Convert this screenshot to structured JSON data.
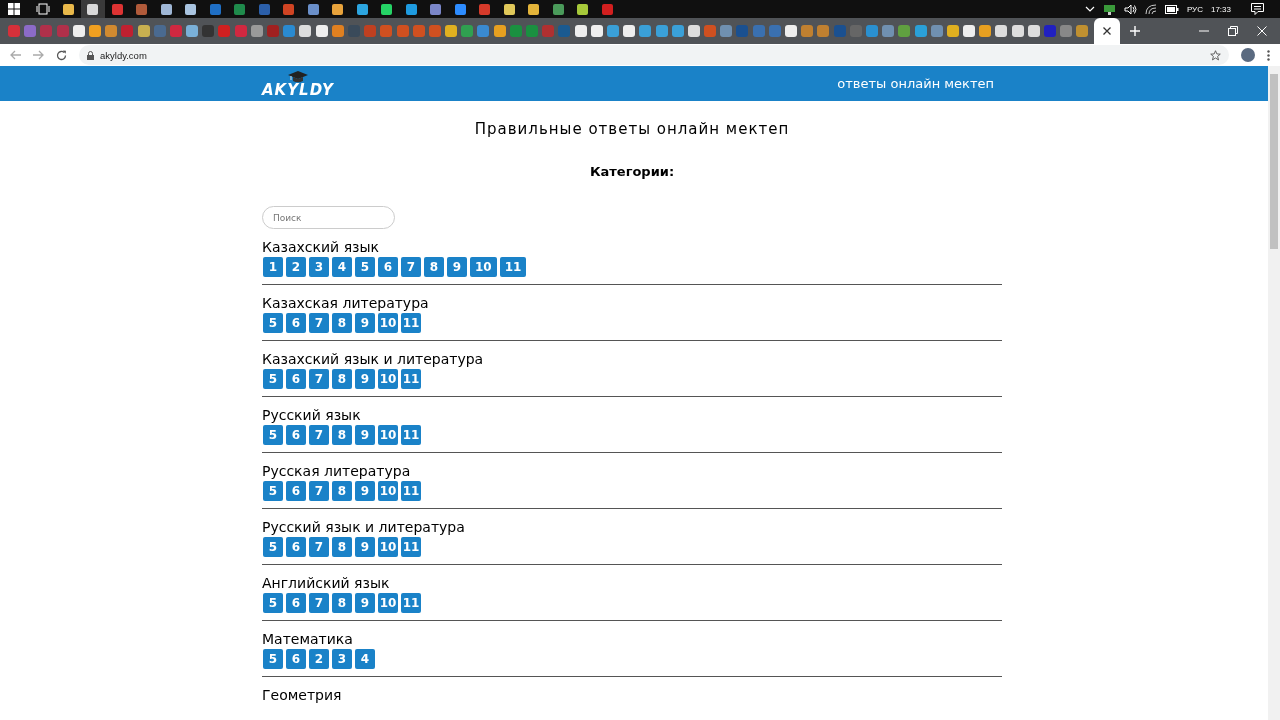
{
  "taskbar": {
    "language": "РУС",
    "time": "17:33"
  },
  "browser": {
    "url": "akyldy.com"
  },
  "site": {
    "logo": "AKYLDY",
    "nav_link": "ответы онлайн мектеп"
  },
  "page": {
    "title": "Правильные ответы онлайн мектеп",
    "categories_heading": "Категории:",
    "search": {
      "placeholder": "Поиск"
    },
    "subjects": [
      {
        "name": "Казахский язык",
        "grades": [
          "1",
          "2",
          "3",
          "4",
          "5",
          "6",
          "7",
          "8",
          "9",
          "10",
          "11"
        ]
      },
      {
        "name": "Казахская литература",
        "grades": [
          "5",
          "6",
          "7",
          "8",
          "9",
          "10",
          "11"
        ]
      },
      {
        "name": "Казахский язык и литература",
        "grades": [
          "5",
          "6",
          "7",
          "8",
          "9",
          "10",
          "11"
        ]
      },
      {
        "name": "Русский язык",
        "grades": [
          "5",
          "6",
          "7",
          "8",
          "9",
          "10",
          "11"
        ]
      },
      {
        "name": "Русская литература",
        "grades": [
          "5",
          "6",
          "7",
          "8",
          "9",
          "10",
          "11"
        ]
      },
      {
        "name": "Русский язык и литература",
        "grades": [
          "5",
          "6",
          "7",
          "8",
          "9",
          "10",
          "11"
        ]
      },
      {
        "name": "Английский язык",
        "grades": [
          "5",
          "6",
          "7",
          "8",
          "9",
          "10",
          "11"
        ]
      },
      {
        "name": "Математика",
        "grades": [
          "5",
          "6",
          "2",
          "3",
          "4"
        ]
      },
      {
        "name": "Геометрия"
      }
    ]
  }
}
